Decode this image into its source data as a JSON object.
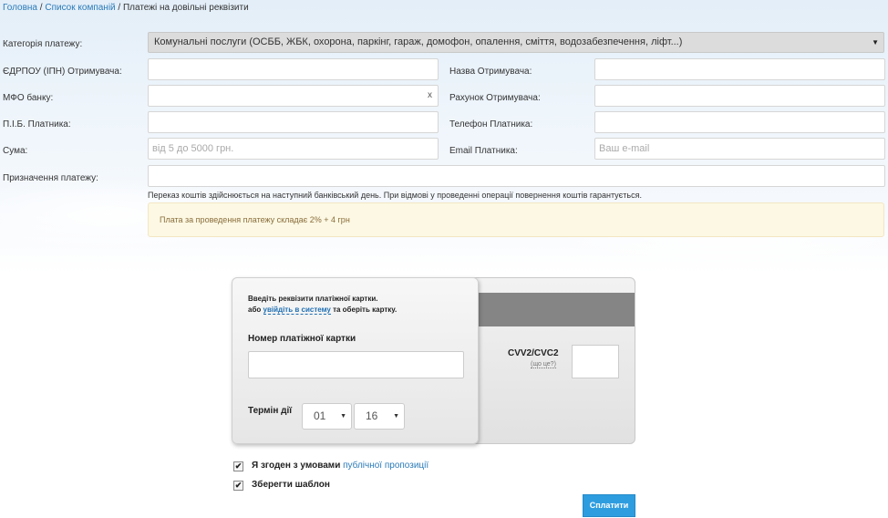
{
  "breadcrumb": {
    "home": "Головна",
    "sep1": " / ",
    "companies": "Список компаній",
    "sep2": " / ",
    "current": "Платежі на довільні реквізити"
  },
  "form": {
    "category_label": "Категорія платежу:",
    "category_value": "Комунальні послуги (ОСББ, ЖБК, охорона, паркінг, гараж, домофон, опалення, сміття, водозабезпечення, ліфт...)",
    "edrpou_label": "ЄДРПОУ (ІПН) Отримувача:",
    "recipient_name_label": "Назва Отримувача:",
    "mfo_label": "МФО банку:",
    "mfo_clear": "x",
    "account_label": "Рахунок Отримувача:",
    "payer_name_label": "П.І.Б. Платника:",
    "payer_phone_label": "Телефон Платника:",
    "amount_label": "Сума:",
    "amount_placeholder": "від 5 до 5000 грн.",
    "email_label": "Email Платника:",
    "email_placeholder": "Ваш e-mail",
    "purpose_label": "Призначення платежу:",
    "note": "Переказ коштів здійснюється на наступний банківський день. При відмові у проведенні операції повернення коштів гарантується.",
    "fee": "Плата за проведення платежу складає 2% + 4 грн"
  },
  "card": {
    "intro_line1": "Введіть реквізити платіжної картки.",
    "intro_prefix": "або ",
    "intro_login": "увійдіть в систему",
    "intro_suffix": " та оберіть картку.",
    "number_label": "Номер платіжної картки",
    "term_label": "Термін дії",
    "month": "01",
    "year": "16",
    "cvv_label": "CVV2/CVC2",
    "cvv_help": "(що це?)"
  },
  "agreements": {
    "agree_text": "Я згоден з умовами ",
    "agree_link": "публічної пропозиції",
    "agree_checked": true,
    "save_template": "Зберегти шаблон",
    "save_checked": true
  },
  "actions": {
    "pay": "Сплатити"
  },
  "icons": {
    "select_arrow": "triangle-down",
    "checkbox_mark": "check-mark"
  },
  "colors": {
    "link": "#2a7ab8",
    "primary_button": "#2e9de0",
    "fee_background": "#fcf8e3",
    "fee_text": "#8a6d3b",
    "card_stripe": "#858585"
  }
}
